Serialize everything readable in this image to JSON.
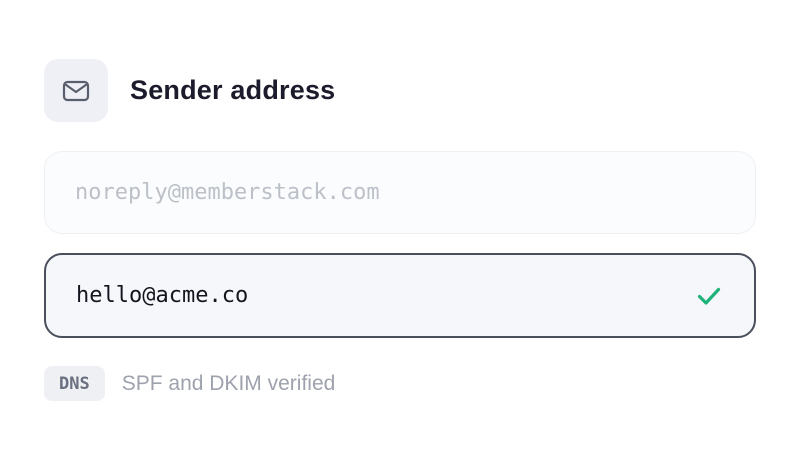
{
  "header": {
    "icon": "mail-icon",
    "title": "Sender address"
  },
  "default_field": {
    "placeholder": "noreply@memberstack.com",
    "value": ""
  },
  "custom_field": {
    "value": "hello@acme.co",
    "status_icon": "check-icon",
    "status_color": "#1fb37a"
  },
  "verification": {
    "badge": "DNS",
    "text": "SPF and DKIM verified"
  }
}
